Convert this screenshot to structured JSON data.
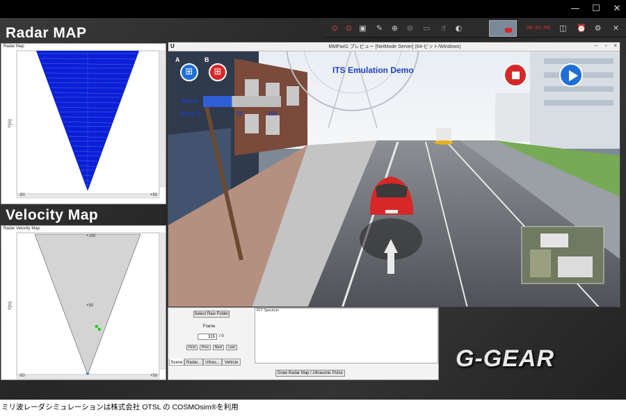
{
  "window": {
    "minimize_glyph": "—",
    "maximize_glyph": "☐",
    "close_glyph": "✕"
  },
  "toolbar": {
    "timer": "00:01:09",
    "icons": [
      "stop-icon",
      "pause-icon",
      "window-icon",
      "pen-icon",
      "zoom-icon",
      "zoom-x1-icon",
      "text-icon",
      "hand-icon",
      "webcam-icon",
      "screenshot-icon",
      "alarm-icon",
      "settings-icon",
      "close-icon"
    ]
  },
  "radar_map": {
    "section_title": "Radar MAP",
    "panel_title": "Radar Map",
    "y_label": "Y[m]",
    "x_min_label": "-50",
    "x_max_label": "+50",
    "fan_color": "#0a1fd6"
  },
  "velocity_map": {
    "section_title": "Velocity Map",
    "panel_title": "Radar Velocity Map",
    "y_label": "Y[m]",
    "top_label": "+100",
    "mid_label": "+50",
    "x_min_label": "-50",
    "x_max_label": "+50",
    "fan_color": "#d4d4d4",
    "points": [
      {
        "x": 0.56,
        "y": 0.34
      },
      {
        "x": 0.58,
        "y": 0.32
      }
    ]
  },
  "game": {
    "title": "MMPart1 プレビュー [NetMode Server] (64-ビット/Windows)",
    "hud_title": "ITS Emulation Demo",
    "label_a": "A",
    "label_b": "B",
    "speed_label": "Speed",
    "accel_label": "Accel 0",
    "tick_50": "50",
    "tick_100": "100",
    "speed_fraction": 0.37,
    "accent_red": "#d62828",
    "accent_blue": "#1f6fd6"
  },
  "controls": {
    "select_raw_folder": "Select Raw Folder",
    "frame_label": "Frame",
    "frame_value": "315",
    "frame_total": "/ 0",
    "btn_first": "First",
    "btn_prev": "Prev",
    "btn_next": "Next",
    "btn_last": "Last",
    "fft_label": "FFT Spectrum",
    "draw_button": "Draw Radar Map / Ultrasonic Pulse",
    "tabs": [
      "Scene",
      "Radar...",
      "Ultras...",
      "Vehicle"
    ]
  },
  "logo": "G-GEAR",
  "caption": "ミリ波レーダシミュレーションは株式会社 OTSL の COSMOsim®を利用"
}
